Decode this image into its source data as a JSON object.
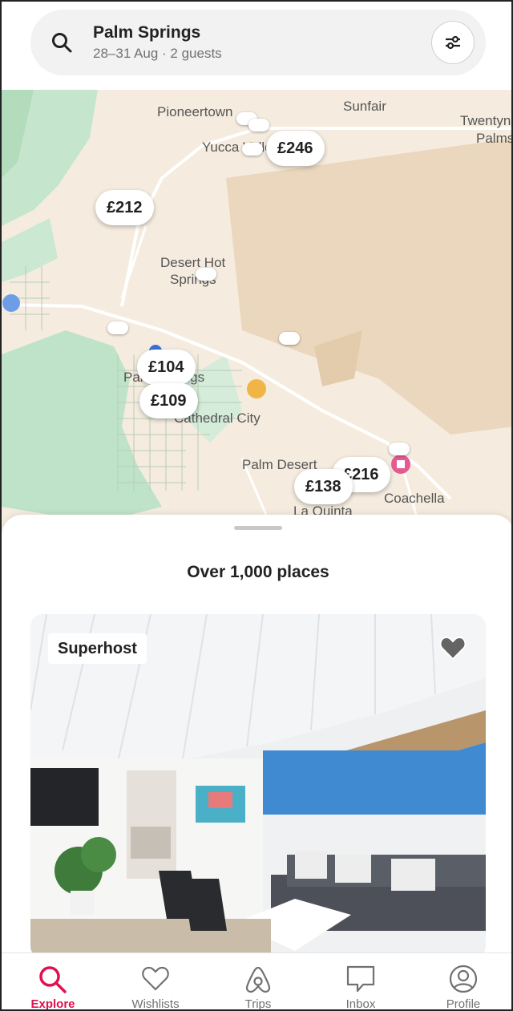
{
  "search": {
    "title": "Palm Springs",
    "subtitle": "28–31 Aug · 2 guests"
  },
  "map": {
    "places": [
      {
        "name": "Pioneertown"
      },
      {
        "name": "Sunfair"
      },
      {
        "name": "Twentyn"
      },
      {
        "name": "Palms"
      },
      {
        "name": "Yucca Valley"
      },
      {
        "name": "Desert Hot"
      },
      {
        "name": "Springs"
      },
      {
        "name": "Palm Springs"
      },
      {
        "name": "Cathedral City"
      },
      {
        "name": "Palm Desert"
      },
      {
        "name": "La Quinta"
      },
      {
        "name": "Coachella"
      }
    ],
    "prices": [
      "£246",
      "£212",
      "£104",
      "£109",
      "£216",
      "£138"
    ]
  },
  "sheet": {
    "count": "Over 1,000 places"
  },
  "listing": {
    "badge": "Superhost"
  },
  "nav": {
    "items": [
      {
        "label": "Explore",
        "icon": "search-icon",
        "active": true
      },
      {
        "label": "Wishlists",
        "icon": "heart-icon",
        "active": false
      },
      {
        "label": "Trips",
        "icon": "airbnb-logo-icon",
        "active": false
      },
      {
        "label": "Inbox",
        "icon": "message-icon",
        "active": false
      },
      {
        "label": "Profile",
        "icon": "profile-icon",
        "active": false
      }
    ]
  },
  "colors": {
    "accent": "#e0114f",
    "map_land": "#f5ecdf",
    "map_green": "#bfe3c8"
  }
}
